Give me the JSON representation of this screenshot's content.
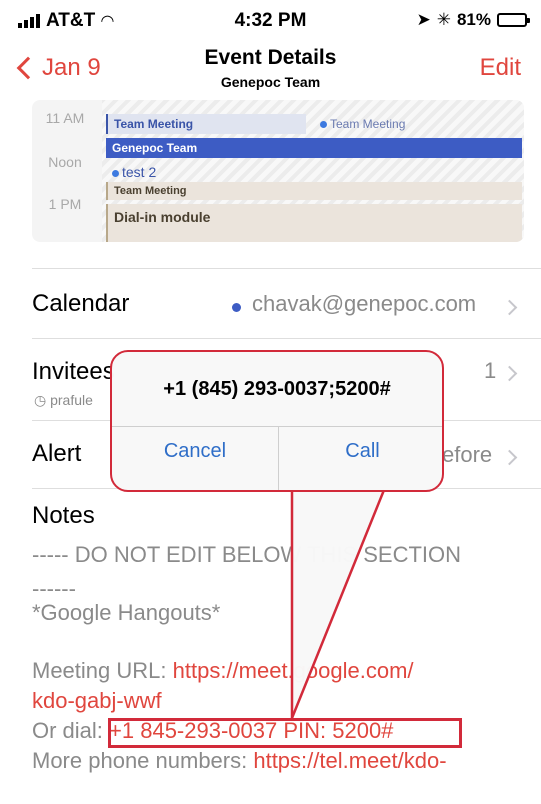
{
  "status_bar": {
    "carrier": "AT&T",
    "time": "4:32 PM",
    "battery": "81%",
    "battery_fraction": 0.81
  },
  "nav": {
    "back_label": "Jan 9",
    "title": "Event Details",
    "subtitle": "Genepoc Team",
    "edit_label": "Edit"
  },
  "calendar_preview": {
    "times": [
      "11 AM",
      "Noon",
      "1 PM"
    ],
    "events": [
      "Team Meeting",
      "Team Meeting",
      "Genepoc Team",
      "test 2",
      "Team Meeting",
      "Dial-in module"
    ]
  },
  "calendar_row": {
    "label": "Calendar",
    "value": "chavak@genepoc.com",
    "dot_color": "#3d5cc4"
  },
  "invitees_row": {
    "label": "Invitees",
    "count": "1",
    "sub": "prafule"
  },
  "alert_row": {
    "label": "Alert",
    "value": "efore"
  },
  "notes": {
    "heading": "Notes",
    "line1": "----- DO NOT EDIT BELOW THIS SECTION",
    "line2": "------",
    "line3": "*Google Hangouts*",
    "url_label": "Meeting URL: ",
    "url_line1": "https://meet.google.com/",
    "url_line2": "kdo-gabj-wwf",
    "dial_label": "Or dial: ",
    "dial_value": "+1 845-293-0037 PIN: 5200#",
    "more_label": "More phone numbers: ",
    "more_value": "https://tel.meet/kdo-"
  },
  "popup": {
    "message": "+1 (845) 293-0037;5200#",
    "cancel": "Cancel",
    "call": "Call"
  },
  "colors": {
    "accent": "#e0463e",
    "annotation": "#d22a3a",
    "ios_blue": "#2f6ec8"
  }
}
